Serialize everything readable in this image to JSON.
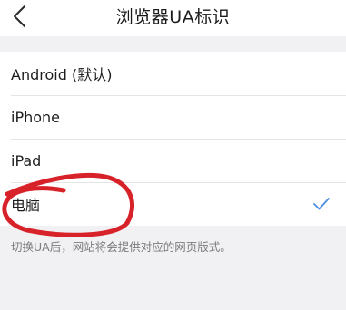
{
  "header": {
    "title": "浏览器UA标识",
    "back_icon": "chevron-left-icon"
  },
  "options": [
    {
      "label": "Android (默认)",
      "selected": false
    },
    {
      "label": "iPhone",
      "selected": false
    },
    {
      "label": "iPad",
      "selected": false
    },
    {
      "label": "电脑",
      "selected": true
    }
  ],
  "hint": "切换UA后，网站将会提供对应的网页版式。",
  "colors": {
    "accent": "#4a90e2",
    "annotation": "#d8222a",
    "background": "#f1f1f3"
  }
}
